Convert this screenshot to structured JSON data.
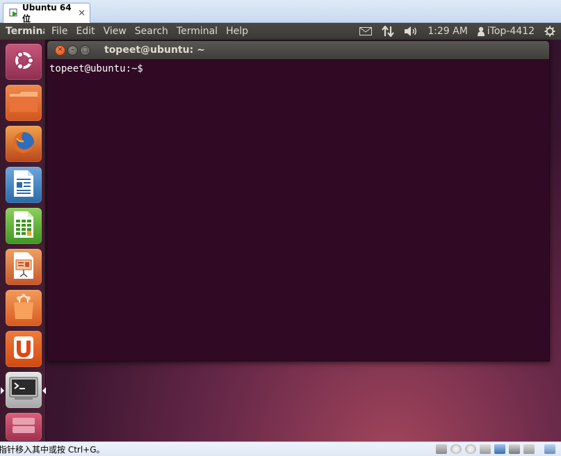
{
  "vm": {
    "tab_title": "Ubuntu 64 位",
    "tab_close": "✕",
    "status_text": "指针移入其中或按 Ctrl+G。"
  },
  "panel": {
    "app_name": "Terminal",
    "menus": [
      "File",
      "Edit",
      "View",
      "Search",
      "Terminal",
      "Help"
    ],
    "clock": "1:29 AM",
    "user": "iTop-4412"
  },
  "launcher": {
    "items": [
      "dash-home",
      "files",
      "firefox",
      "libreoffice-writer",
      "libreoffice-calc",
      "libreoffice-impress",
      "ubuntu-software-center",
      "ubuntu-one",
      "terminal",
      "more"
    ]
  },
  "terminal": {
    "title": "topeet@ubuntu: ~",
    "prompt": "topeet@ubuntu:~$",
    "background": "#300a24"
  },
  "colors": {
    "ubuntu_orange": "#dd4814",
    "panel": "#3c3b37",
    "vm_chrome": "#d6e4f5"
  }
}
